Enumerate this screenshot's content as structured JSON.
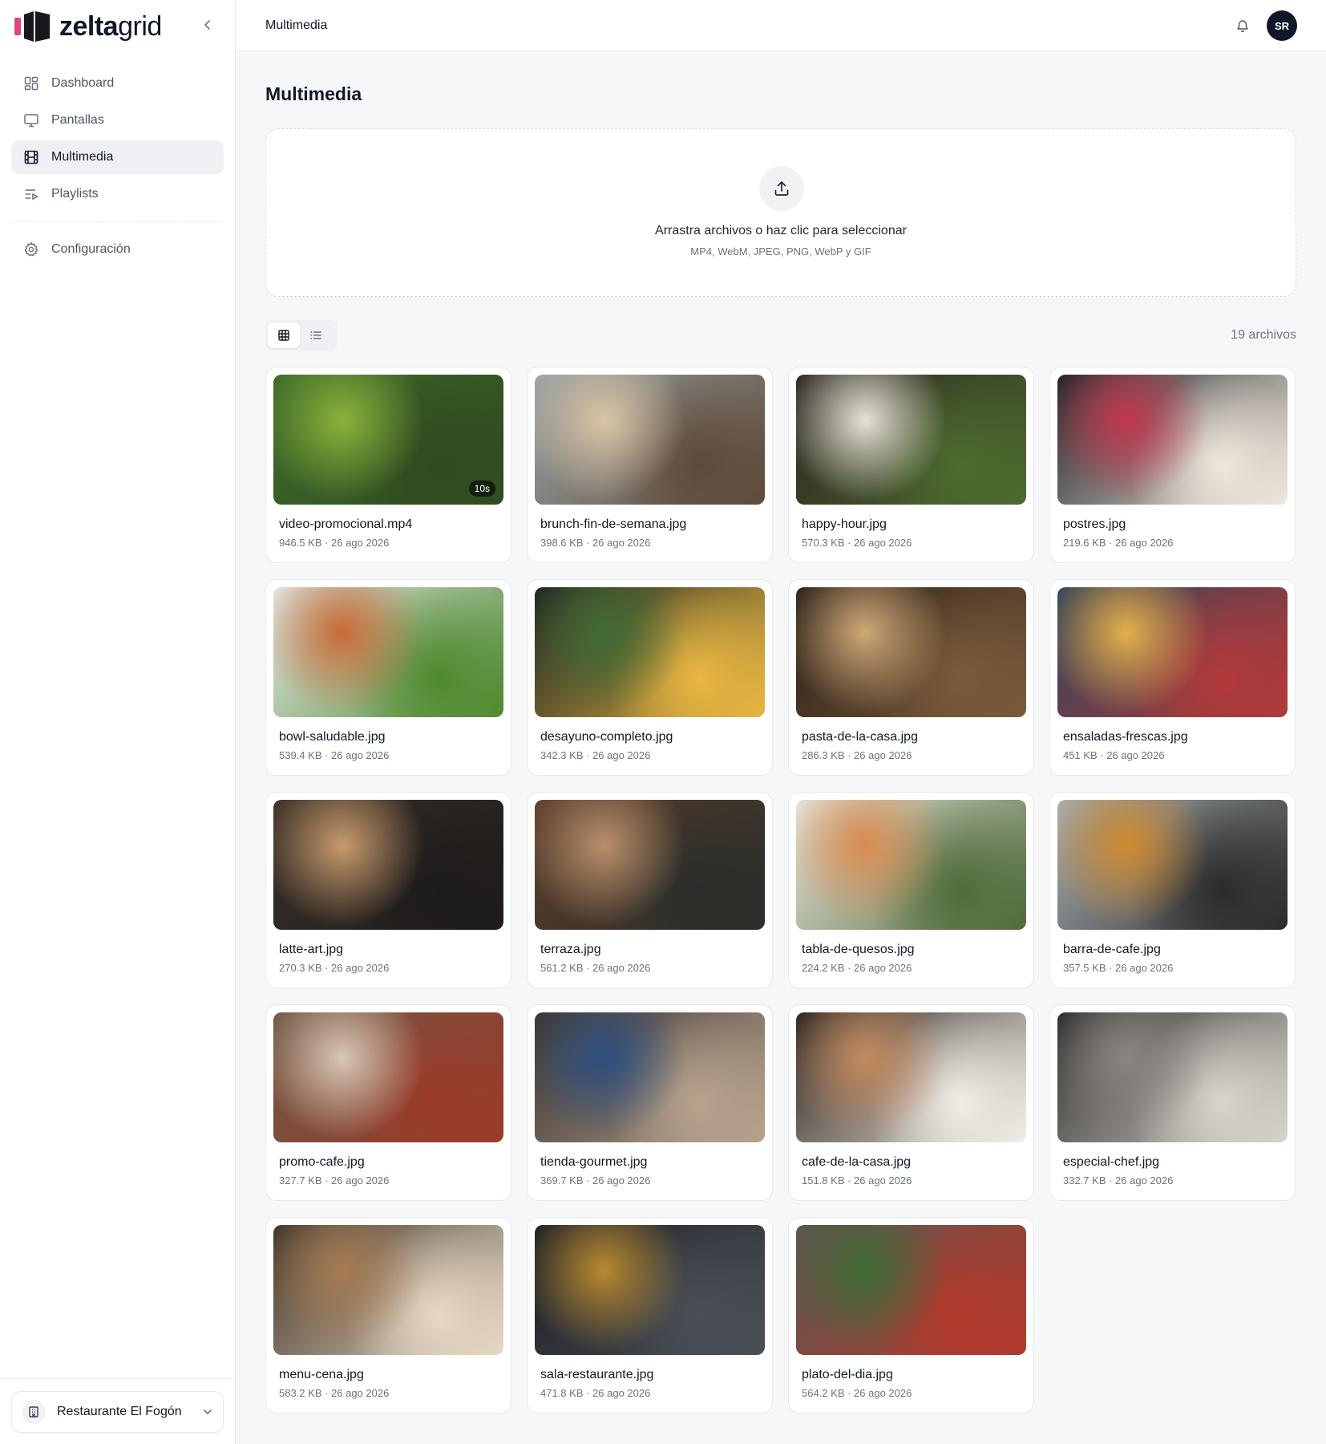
{
  "brand": {
    "name_bold": "zelta",
    "name_light": "grid"
  },
  "sidebar": {
    "items": [
      {
        "label": "Dashboard",
        "icon": "dashboard-icon",
        "active": false
      },
      {
        "label": "Pantallas",
        "icon": "monitor-icon",
        "active": false
      },
      {
        "label": "Multimedia",
        "icon": "film-icon",
        "active": true
      },
      {
        "label": "Playlists",
        "icon": "playlist-icon",
        "active": false
      }
    ],
    "settings": {
      "label": "Configuración",
      "icon": "gear-icon"
    },
    "org": {
      "name": "Restaurante El Fogón",
      "icon": "building-icon"
    }
  },
  "topbar": {
    "breadcrumb": "Multimedia",
    "avatar_initials": "SR"
  },
  "main": {
    "title": "Multimedia",
    "dropzone": {
      "title": "Arrastra archivos o haz clic para seleccionar",
      "subtitle": "MP4, WebM, JPEG, PNG, WebP y GIF"
    },
    "file_count": "19 archivos",
    "view_mode": "grid"
  },
  "files": [
    {
      "name": "video-promocional.mp4",
      "meta": "946.5 KB · 26 ago 2026",
      "duration": "10s",
      "colors": [
        "#3d6b2b",
        "#8ab33a",
        "#2f4a1f"
      ]
    },
    {
      "name": "brunch-fin-de-semana.jpg",
      "meta": "398.6 KB · 26 ago 2026",
      "duration": "",
      "colors": [
        "#9aa3a6",
        "#d9c4a3",
        "#5e4a3a"
      ]
    },
    {
      "name": "happy-hour.jpg",
      "meta": "570.3 KB · 26 ago 2026",
      "duration": "",
      "colors": [
        "#2b2521",
        "#e8e1d7",
        "#4d6a2e"
      ]
    },
    {
      "name": "postres.jpg",
      "meta": "219.6 KB · 26 ago 2026",
      "duration": "",
      "colors": [
        "#1f2326",
        "#c2364f",
        "#f1e7dc"
      ]
    },
    {
      "name": "bowl-saludable.jpg",
      "meta": "539.4 KB · 26 ago 2026",
      "duration": "",
      "colors": [
        "#e6e7e9",
        "#c86a35",
        "#4e8a2f"
      ]
    },
    {
      "name": "desayuno-completo.jpg",
      "meta": "342.3 KB · 26 ago 2026",
      "duration": "",
      "colors": [
        "#1b2421",
        "#3f6b35",
        "#e9b742"
      ]
    },
    {
      "name": "pasta-de-la-casa.jpg",
      "meta": "286.3 KB · 26 ago 2026",
      "duration": "",
      "colors": [
        "#2a1f18",
        "#cfa977",
        "#7a5a3b"
      ]
    },
    {
      "name": "ensaladas-frescas.jpg",
      "meta": "451 KB · 26 ago 2026",
      "duration": "",
      "colors": [
        "#2f4459",
        "#e3b14a",
        "#b23a3a"
      ]
    },
    {
      "name": "latte-art.jpg",
      "meta": "270.3 KB · 26 ago 2026",
      "duration": "",
      "colors": [
        "#3a3029",
        "#c79a6c",
        "#1d1b1a"
      ]
    },
    {
      "name": "terraza.jpg",
      "meta": "561.2 KB · 26 ago 2026",
      "duration": "",
      "colors": [
        "#5b3e2c",
        "#b88f6a",
        "#2a2d2a"
      ]
    },
    {
      "name": "tabla-de-quesos.jpg",
      "meta": "224.2 KB · 26 ago 2026",
      "duration": "",
      "colors": [
        "#eae6e0",
        "#d98b4f",
        "#4f6b3a"
      ]
    },
    {
      "name": "barra-de-cafe.jpg",
      "meta": "357.5 KB · 26 ago 2026",
      "duration": "",
      "colors": [
        "#a9b0b3",
        "#d0892f",
        "#2b2b2b"
      ]
    },
    {
      "name": "promo-cafe.jpg",
      "meta": "327.7 KB · 26 ago 2026",
      "duration": "",
      "colors": [
        "#6f5643",
        "#d8c7b4",
        "#9b3b2a"
      ]
    },
    {
      "name": "tienda-gourmet.jpg",
      "meta": "369.7 KB · 26 ago 2026",
      "duration": "",
      "colors": [
        "#3b3330",
        "#2c4f80",
        "#b8a38d"
      ]
    },
    {
      "name": "cafe-de-la-casa.jpg",
      "meta": "151.8 KB · 26 ago 2026",
      "duration": "",
      "colors": [
        "#2a211c",
        "#c58b5d",
        "#f2ede6"
      ]
    },
    {
      "name": "especial-chef.jpg",
      "meta": "332.7 KB · 26 ago 2026",
      "duration": "",
      "colors": [
        "#2c2b2a",
        "#8a8580",
        "#d9d4cc"
      ]
    },
    {
      "name": "menu-cena.jpg",
      "meta": "583.2 KB · 26 ago 2026",
      "duration": "",
      "colors": [
        "#3f3227",
        "#a67c52",
        "#e7d9c4"
      ]
    },
    {
      "name": "sala-restaurante.jpg",
      "meta": "471.8 KB · 26 ago 2026",
      "duration": "",
      "colors": [
        "#1d2024",
        "#b9892f",
        "#4a4f57"
      ]
    },
    {
      "name": "plato-del-dia.jpg",
      "meta": "564.2 KB · 26 ago 2026",
      "duration": "",
      "colors": [
        "#5c5550",
        "#3e6b34",
        "#b33a2c"
      ]
    }
  ]
}
